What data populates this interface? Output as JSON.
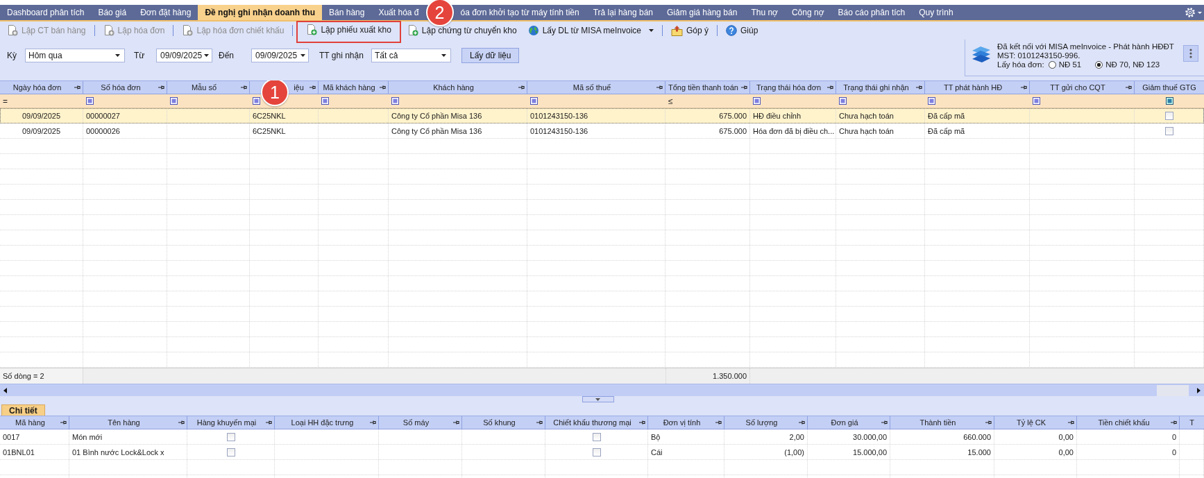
{
  "tabs": [
    {
      "label": "Dashboard phân tích",
      "selected": false
    },
    {
      "label": "Báo giá",
      "selected": false
    },
    {
      "label": "Đơn đặt hàng",
      "selected": false
    },
    {
      "label": "Đề nghị ghi nhận doanh thu",
      "selected": true
    },
    {
      "label": "Bán hàng",
      "selected": false
    },
    {
      "label": "Xuất hóa đ",
      "selected": false
    },
    {
      "label": "óa đơn khởi tạo từ máy tính tiền",
      "selected": false,
      "badge": "2"
    },
    {
      "label": "Trả lại hàng bán",
      "selected": false
    },
    {
      "label": "Giảm giá hàng bán",
      "selected": false
    },
    {
      "label": "Thu nợ",
      "selected": false
    },
    {
      "label": "Công nợ",
      "selected": false
    },
    {
      "label": "Báo cáo phân tích",
      "selected": false
    },
    {
      "label": "Quy trình",
      "selected": false
    }
  ],
  "toolbar": {
    "groups": [
      [
        {
          "label": "Lập CT bán hàng",
          "kind": "create",
          "disabled": true,
          "highlighted": false
        }
      ],
      [
        {
          "label": "Lập hóa đơn",
          "kind": "create",
          "disabled": true,
          "highlighted": false
        }
      ],
      [
        {
          "label": "Lập hóa đơn chiết khấu",
          "kind": "create",
          "disabled": true,
          "highlighted": false
        }
      ],
      [
        {
          "label": "Lập phiếu xuất kho",
          "kind": "create",
          "disabled": false,
          "highlighted": true
        },
        {
          "label": "Lập chứng từ chuyển kho",
          "kind": "create",
          "disabled": false,
          "highlighted": false
        },
        {
          "label": "Lấy DL từ MISA meInvoice",
          "kind": "fetch",
          "disabled": false,
          "highlighted": false,
          "has_menu": true
        }
      ],
      [
        {
          "label": "Góp ý",
          "kind": "feedback",
          "disabled": false,
          "highlighted": false
        }
      ],
      [
        {
          "label": "Giúp",
          "kind": "help",
          "disabled": false,
          "highlighted": false
        }
      ]
    ]
  },
  "filters": [
    {
      "label": "Kỳ",
      "kind": "combo",
      "value": "Hôm qua"
    },
    {
      "label": "Từ",
      "kind": "date",
      "value": "09/09/2025"
    },
    {
      "label": "Đến",
      "kind": "date",
      "value": "09/09/2025"
    },
    {
      "label": "TT ghi nhận",
      "kind": "combo",
      "value": "Tất cả"
    }
  ],
  "fetch_button": "Lấy dữ liệu",
  "connection": {
    "message": "Đã kết nối với MISA meInvoice - Phát hành HĐĐT",
    "tax_code": "MST: 0101243150-996.",
    "option_label": "Lấy hóa đơn:",
    "options": [
      {
        "label": "NĐ 51",
        "selected": false
      },
      {
        "label": "NĐ 70, NĐ 123",
        "selected": true
      }
    ]
  },
  "main_grid": {
    "columns": [
      {
        "label": "Ngày hóa đơn",
        "kind": "date"
      },
      {
        "label": "Số hóa đơn",
        "kind": "text"
      },
      {
        "label": "Mẫu số",
        "kind": "text"
      },
      {
        "label": "iệu",
        "kind": "text",
        "badge": "1"
      },
      {
        "label": "Mã khách hàng",
        "kind": "text"
      },
      {
        "label": "Khách hàng",
        "kind": "text"
      },
      {
        "label": "Mã số thuế",
        "kind": "text"
      },
      {
        "label": "Tổng tiền thanh toán",
        "kind": "amount"
      },
      {
        "label": "Trạng thái hóa đơn",
        "kind": "text"
      },
      {
        "label": "Trạng thái ghi nhận",
        "kind": "text"
      },
      {
        "label": "TT phát hành HĐ",
        "kind": "text"
      },
      {
        "label": "TT gửi cho CQT",
        "kind": "text"
      },
      {
        "label": "Giảm thuế GTG",
        "kind": "check",
        "truncated": true
      }
    ],
    "filter_row": [
      {
        "kind": "operator",
        "text": "="
      },
      {
        "kind": "icon"
      },
      {
        "kind": "icon"
      },
      {
        "kind": "icon"
      },
      {
        "kind": "icon"
      },
      {
        "kind": "icon"
      },
      {
        "kind": "icon"
      },
      {
        "kind": "operator",
        "text": "≤"
      },
      {
        "kind": "icon"
      },
      {
        "kind": "icon"
      },
      {
        "kind": "icon"
      },
      {
        "kind": "icon"
      },
      {
        "kind": "check"
      }
    ],
    "rows": [
      {
        "selected": true,
        "cells": [
          "09/09/2025",
          "00000027",
          null,
          "6C25NKL",
          null,
          "Công ty Cổ phần Misa 136",
          "0101243150-136",
          "675.000",
          "HĐ điều chỉnh",
          "Chưa hạch toán",
          "Đã cấp mã",
          null,
          false
        ]
      },
      {
        "selected": false,
        "cells": [
          "09/09/2025",
          "00000026",
          null,
          "6C25NKL",
          null,
          "Công ty Cổ phần Misa 136",
          "0101243150-136",
          "675.000",
          "Hóa đơn đã bị điều ch...",
          "Chưa hạch toán",
          "Đã cấp mã",
          null,
          false
        ]
      }
    ],
    "footer": {
      "count": "Số dòng = 2",
      "total": "1.350.000"
    }
  },
  "detail_tabs": [
    {
      "label": "Chi tiết",
      "selected": true
    }
  ],
  "detail_grid": {
    "columns": [
      {
        "label": "Mã hàng",
        "kind": "text"
      },
      {
        "label": "Tên hàng",
        "kind": "text"
      },
      {
        "label": "Hàng khuyến mại",
        "kind": "check"
      },
      {
        "label": "Loại HH đặc trưng",
        "kind": "text"
      },
      {
        "label": "Số máy",
        "kind": "text"
      },
      {
        "label": "Số khung",
        "kind": "text"
      },
      {
        "label": "Chiết khấu thương mại",
        "kind": "check"
      },
      {
        "label": "Đơn vị tính",
        "kind": "text"
      },
      {
        "label": "Số lượng",
        "kind": "amount"
      },
      {
        "label": "Đơn giá",
        "kind": "amount"
      },
      {
        "label": "Thành tiền",
        "kind": "amount"
      },
      {
        "label": "Tỷ lệ CK",
        "kind": "amount"
      },
      {
        "label": "Tiền chiết khấu",
        "kind": "amount"
      },
      {
        "label": "T",
        "kind": "text",
        "truncated": true
      }
    ],
    "rows": [
      {
        "cells": [
          "0017",
          "Món mới",
          false,
          null,
          null,
          null,
          false,
          "Bộ",
          "2,00",
          "30.000,00",
          "660.000",
          "0,00",
          "0",
          null
        ]
      },
      {
        "cells": [
          "01BNL01",
          "01 Bình nước Lock&Lock x",
          false,
          null,
          null,
          null,
          false,
          "Cái",
          "(1,00)",
          "15.000,00",
          "15.000",
          "0,00",
          "0",
          null
        ]
      }
    ]
  }
}
